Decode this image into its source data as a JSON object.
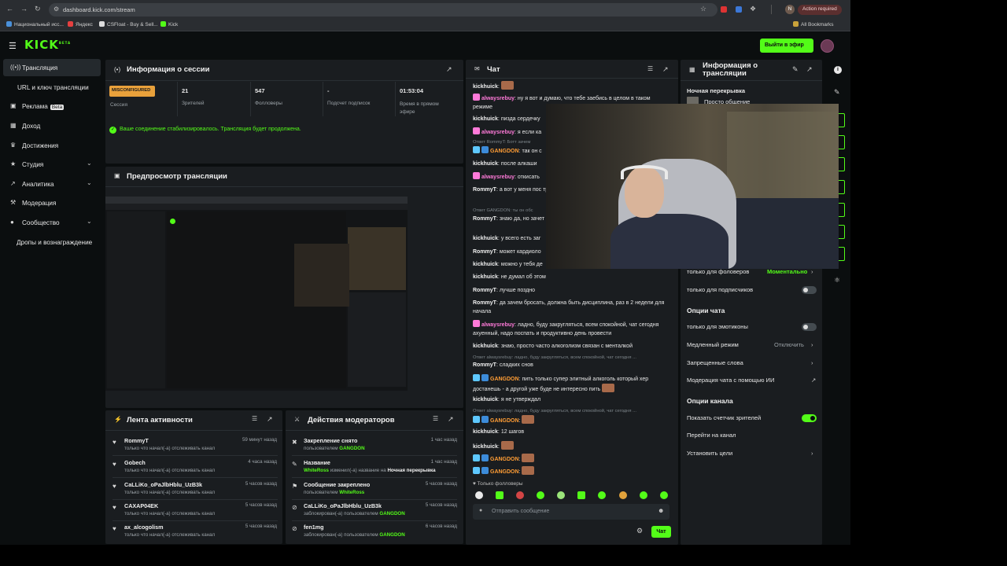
{
  "browser": {
    "url": "dashboard.kick.com/stream",
    "action_required": "Action required",
    "all_bookmarks": "All Bookmarks",
    "bookmarks": [
      "Национальный исс...",
      "Яндекс",
      "CSFloat - Buy & Sell...",
      "Kick"
    ],
    "profile_letter": "N"
  },
  "topbar": {
    "logo": "KICK",
    "logo_badge": "BETA",
    "go_live": "Выйти в эфир"
  },
  "sidebar": {
    "items": [
      {
        "label": "Трансляция",
        "icon": "broadcast-icon"
      },
      {
        "label": "URL и ключ трансляции"
      },
      {
        "label": "Реклама",
        "badge": "Beta",
        "icon": "ads-icon"
      },
      {
        "label": "Доход",
        "icon": "income-icon"
      },
      {
        "label": "Достижения",
        "icon": "trophy-icon"
      },
      {
        "label": "Студия",
        "icon": "studio-icon"
      },
      {
        "label": "Аналитика",
        "icon": "analytics-icon"
      },
      {
        "label": "Модерация",
        "icon": "moderation-icon"
      },
      {
        "label": "Сообщество",
        "icon": "community-icon"
      },
      {
        "label": "Дропы и вознаграждение"
      }
    ]
  },
  "session": {
    "title": "Информация о сессии",
    "status_badge": "MISCONFIGURED",
    "stats": [
      {
        "value": "",
        "label": "Сессия"
      },
      {
        "value": "21",
        "label": "Зрителей"
      },
      {
        "value": "547",
        "label": "Фолловеры"
      },
      {
        "value": "-",
        "label": "Подсчет подписок"
      },
      {
        "value": "01:53:04",
        "label": "Время в прямом эфире"
      }
    ],
    "notice": "Ваше соединение стабилизировалось. Трансляция будет продолжена."
  },
  "preview": {
    "title": "Предпросмотр трансляции"
  },
  "activity": {
    "title": "Лента активности",
    "rows": [
      {
        "name": "RommyT",
        "time": "59 минут назад",
        "sub": "только что начал(-а) отслеживать канал"
      },
      {
        "name": "Gobech",
        "time": "4 часа назад",
        "sub": "только что начал(-а) отслеживать канал"
      },
      {
        "name": "CaLLiKo_oPaJlbHblu_UzB3k",
        "time": "5 часов назад",
        "sub": "только что начал(-а) отслеживать канал"
      },
      {
        "name": "CAXAP04EK",
        "time": "5 часов назад",
        "sub": "только что начал(-а) отслеживать канал"
      },
      {
        "name": "ax_alcogolism",
        "time": "5 часов назад",
        "sub": "только что начал(-а) отслеживать канал"
      }
    ]
  },
  "modactions": {
    "title": "Действия модераторов",
    "rows": [
      {
        "name": "Закрепление снято",
        "time": "1 час назад",
        "sub": "пользователем",
        "by": "GANGDON"
      },
      {
        "name": "Название",
        "time": "1 час назад",
        "sub_by": "WhiteRoss",
        "sub": "изменил(-а) название на",
        "target": "Ночная перекрывка"
      },
      {
        "name": "Сообщение закреплено",
        "time": "5 часов назад",
        "sub": "пользователем",
        "by": "WhiteRoss"
      },
      {
        "name": "CaLLiKo_oPaJlbHblu_UzB3k",
        "time": "5 часов назад",
        "sub": "заблокирован(-а) пользователем",
        "by": "GANGDON"
      },
      {
        "name": "fen1mg",
        "time": "6 часов назад",
        "sub": "заблокирован(-а) пользователем",
        "by": "GANGDON"
      }
    ]
  },
  "chat": {
    "title": "Чат",
    "messages": [
      {
        "user": "kickhuick",
        "text": "",
        "color": "white",
        "emote": true
      },
      {
        "user": "alwaysrebuy",
        "text": "ну я вот и думаю, что тебе заебись в целом в таком режиме",
        "color": "pink"
      },
      {
        "user": "kickhuick",
        "text": "пизда сердечку",
        "color": "white"
      },
      {
        "user": "alwaysrebuy",
        "text": "я если ка",
        "color": "pink"
      },
      {
        "reply": "Ответ RommyT: Ботт зачем"
      },
      {
        "user": "GANGDON",
        "text": "так он с",
        "color": "or"
      },
      {
        "user": "kickhuick",
        "text": "после алкаши",
        "color": "white"
      },
      {
        "user": "alwaysrebuy",
        "text": "откисать",
        "color": "pink"
      },
      {
        "user": "RommyT",
        "text": "а вот у меня пос тревожность началась, по",
        "color": "white"
      },
      {
        "reply": "Ответ GANGDON: ты он обс"
      },
      {
        "user": "RommyT",
        "text": "знаю да, но зачет друзья с детства",
        "color": "white"
      },
      {
        "user": "kickhuick",
        "text": "у всего есть заг",
        "color": "white"
      },
      {
        "user": "RommyT",
        "text": "может кардиоло",
        "color": "white"
      },
      {
        "user": "kickhuick",
        "text": "можно у тебя де",
        "color": "white"
      },
      {
        "user": "kickhuick",
        "text": "не думал об этом",
        "color": "white"
      },
      {
        "user": "RommyT",
        "text": "лучше поздно",
        "color": "white"
      },
      {
        "user": "RommyT",
        "text": "да зачем бросать, должна быть дисциплина, раз в 2 недели для начала",
        "color": "white"
      },
      {
        "user": "alwaysrebuy",
        "text": "ладно, буду закругляться, всем спокойной, чат сегодня ахуенный, надо поспать и продуктивно день провести",
        "color": "pink"
      },
      {
        "user": "kickhuick",
        "text": "знаю, просто часто алкоголизм связан с менталкой",
        "color": "white"
      },
      {
        "reply": "Ответ alwaysrebuy: ладно, буду закругляться, всем спокойной, чат сегодня ..."
      },
      {
        "user": "RommyT",
        "text": "сладких снов",
        "color": "white"
      },
      {
        "user": "GANGDON",
        "text": "пить только супер элитный алкоголь который хер достанешь - а другой уже буде не интересно пить",
        "color": "or"
      },
      {
        "user": "kickhuick",
        "text": "я не утверждал",
        "color": "white"
      },
      {
        "reply": "Ответ alwaysrebuy: ладно, буду закругляться, всем спокойной, чат сегодня ..."
      },
      {
        "user": "GANGDON",
        "text": "",
        "color": "or",
        "emote": true
      },
      {
        "user": "kickhuick",
        "text": "12 шагов",
        "color": "white"
      },
      {
        "user": "kickhuick",
        "text": "",
        "color": "white",
        "emote": true
      },
      {
        "user": "GANGDON",
        "text": "",
        "color": "or",
        "emote": true
      },
      {
        "user": "GANGDON",
        "text": "",
        "color": "or",
        "emote": true
      }
    ],
    "followers_only": "Только фолловеры",
    "input_placeholder": "Отправить сообщение",
    "send_label": "Чат"
  },
  "streaminfo": {
    "title": "Информация о трансляции",
    "stream_title_label": "Ночная перекрывка",
    "category": "Просто общение",
    "followers_only_label": "только для фоловеров",
    "followers_only_value": "Моментально",
    "subs_only_label": "только для подписчиков",
    "chat_options_title": "Опции чата",
    "emotes_only_label": "только для эмотиконы",
    "slow_mode_label": "Медленный режим",
    "slow_mode_value": "Отключить",
    "banned_words_label": "Запрещенные слова",
    "ai_mod_label": "Модерация чата с помощью ИИ",
    "channel_options_title": "Опции канала",
    "show_viewers_label": "Показать счетчик зрителей",
    "go_to_channel_label": "Перейти на канал",
    "set_goals_label": "Установить цели"
  },
  "colors": {
    "accent": "#53fc18",
    "panel": "#1a1d20",
    "bg": "#0b0e0f",
    "badge": "#e9a13b"
  }
}
